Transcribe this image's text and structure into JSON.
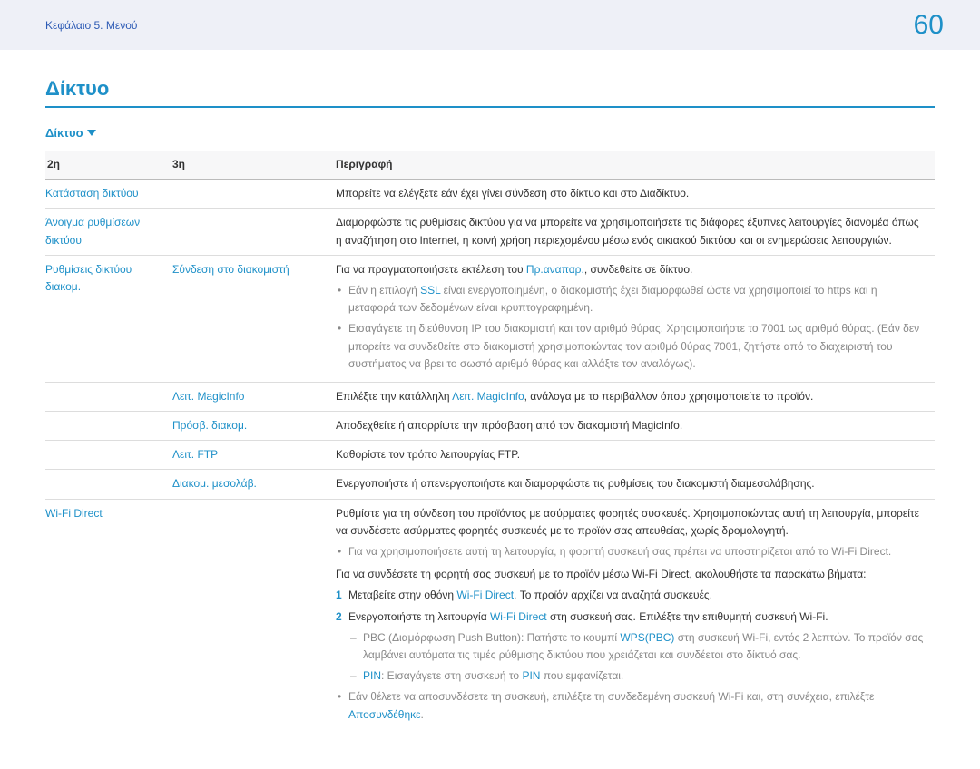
{
  "header": {
    "breadcrumb": "Κεφάλαιο 5. Μενού",
    "page": "60"
  },
  "title": "Δίκτυο",
  "section": "Δίκτυο",
  "table": {
    "head": {
      "c1": "2η",
      "c2": "3η",
      "c3": "Περιγραφή"
    },
    "r1": {
      "c1": "Κατάσταση δικτύου",
      "c3": "Μπορείτε να ελέγξετε εάν έχει γίνει σύνδεση στο δίκτυο και στο Διαδίκτυο."
    },
    "r2": {
      "c1": "Άνοιγμα ρυθμίσεων δικτύου",
      "c3": "Διαμορφώστε τις ρυθμίσεις δικτύου για να μπορείτε να χρησιμοποιήσετε τις διάφορες έξυπνες λειτουργίες διανομέα όπως η αναζήτηση στο Internet, η κοινή χρήση περιεχομένου μέσω ενός οικιακού δικτύου και οι ενημερώσεις λειτουργιών."
    },
    "r3": {
      "c1": "Ρυθμίσεις δικτύου διακομ.",
      "c2": "Σύνδεση στο διακομιστή",
      "l1a": "Για να πραγματοποιήσετε εκτέλεση του ",
      "l1b": "Πρ.αναπαρ.",
      "l1c": ", συνδεθείτε σε δίκτυο.",
      "b1a": "Εάν η επιλογή ",
      "b1b": "SSL",
      "b1c": " είναι ενεργοποιημένη, ο διακομιστής έχει διαμορφωθεί ώστε να χρησιμοποιεί το https και η μεταφορά των δεδομένων είναι κρυπτογραφημένη.",
      "b2": "Εισαγάγετε τη διεύθυνση IP του διακομιστή και τον αριθμό θύρας. Χρησιμοποιήστε το 7001 ως αριθμό θύρας. (Εάν δεν μπορείτε να συνδεθείτε στο διακομιστή χρησιμοποιώντας τον αριθμό θύρας 7001, ζητήστε από το διαχειριστή του συστήματος να βρει το σωστό αριθμό θύρας και αλλάξτε τον αναλόγως)."
    },
    "r4": {
      "c2": "Λειτ. MagicInfo",
      "t1": "Επιλέξτε την κατάλληλη ",
      "t2": "Λειτ. MagicInfo",
      "t3": ", ανάλογα με το περιβάλλον όπου χρησιμοποιείτε το προϊόν."
    },
    "r5": {
      "c2": "Πρόσβ. διακομ.",
      "c3": "Αποδεχθείτε ή απορρίψτε την πρόσβαση από τον διακομιστή MagicInfo."
    },
    "r6": {
      "c2": "Λειτ. FTP",
      "c3": "Καθορίστε τον τρόπο λειτουργίας FTP."
    },
    "r7": {
      "c2": "Διακομ. μεσολάβ.",
      "c3": "Ενεργοποιήστε ή απενεργοποιήστε και διαμορφώστε τις ρυθμίσεις του διακομιστή διαμεσολάβησης."
    },
    "r8": {
      "c1": "Wi-Fi Direct",
      "p1": "Ρυθμίστε για τη σύνδεση του προϊόντος με ασύρματες φορητές συσκευές. Χρησιμοποιώντας αυτή τη λειτουργία, μπορείτε να συνδέσετε ασύρματες φορητές συσκευές με το προϊόν σας απευθείας, χωρίς δρομολογητή.",
      "b1": "Για να χρησιμοποιήσετε αυτή τη λειτουργία, η φορητή συσκευή σας πρέπει να υποστηρίζεται από το Wi-Fi Direct.",
      "p2": "Για να συνδέσετε τη φορητή σας συσκευή με το προϊόν μέσω Wi-Fi Direct, ακολουθήστε τα παρακάτω βήματα:",
      "s1a": "Μεταβείτε στην οθόνη ",
      "s1b": "Wi-Fi Direct",
      "s1c": ". Το προϊόν αρχίζει να αναζητά συσκευές.",
      "s2a": "Ενεργοποιήστε τη λειτουργία ",
      "s2b": "Wi-Fi Direct",
      "s2c": " στη συσκευή σας. Επιλέξτε την επιθυμητή συσκευή Wi-Fi.",
      "d1a": "PBC (Διαμόρφωση Push Button): Πατήστε το κουμπί ",
      "d1b": "WPS(PBC)",
      "d1c": " στη συσκευή Wi-Fi, εντός 2 λεπτών. Το προϊόν σας λαμβάνει αυτόματα τις τιμές ρύθμισης δικτύου που χρειάζεται και συνδέεται στο δίκτυό σας.",
      "d2a": "PIN",
      "d2b": ": Εισαγάγετε στη συσκευή το ",
      "d2c": "PIN",
      "d2d": " που εμφανίζεται.",
      "b2a": "Εάν θέλετε να αποσυνδέσετε τη συσκευή, επιλέξτε τη συνδεδεμένη συσκευή Wi-Fi και, στη συνέχεια, επιλέξτε ",
      "b2b": "Αποσυνδέθηκε",
      "b2c": "."
    }
  }
}
